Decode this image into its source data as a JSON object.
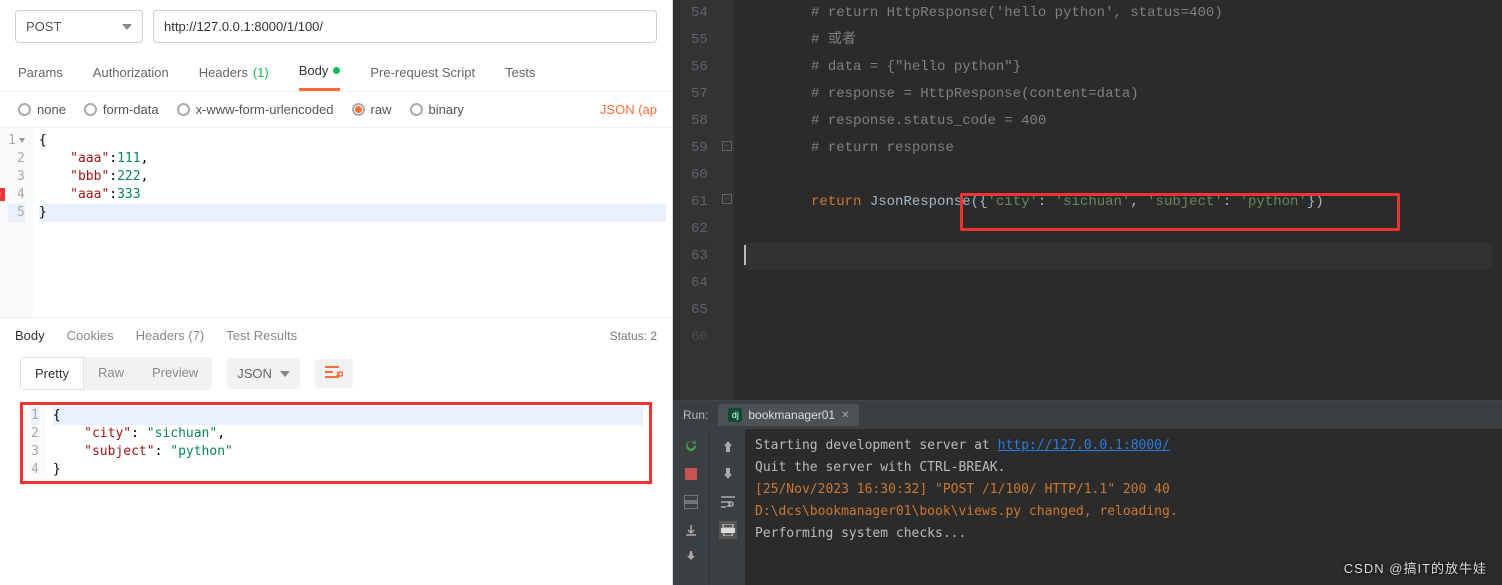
{
  "postman": {
    "method": "POST",
    "url": "http://127.0.0.1:8000/1/100/",
    "tabs": {
      "params": "Params",
      "auth": "Authorization",
      "headers": "Headers",
      "headers_count": "(1)",
      "body": "Body",
      "prerequest": "Pre-request Script",
      "tests": "Tests"
    },
    "body_types": {
      "none": "none",
      "form": "form-data",
      "urlencoded": "x-www-form-urlencoded",
      "raw": "raw",
      "binary": "binary",
      "json_label": "JSON (ap"
    },
    "request_body": {
      "lines": [
        "1",
        "2",
        "3",
        "4",
        "5"
      ],
      "l1": "{",
      "l2_k": "\"aaa\"",
      "l2_p": ":",
      "l2_v": "111",
      "l2_c": ",",
      "l3_k": "\"bbb\"",
      "l3_p": ":",
      "l3_v": "222",
      "l3_c": ",",
      "l4_k": "\"aaa\"",
      "l4_p": ":",
      "l4_v": "333",
      "l5": "}"
    },
    "response_tabs": {
      "body": "Body",
      "cookies": "Cookies",
      "headers": "Headers",
      "headers_count": "(7)",
      "tests": "Test Results",
      "status_label": "Status: 2"
    },
    "view_toolbar": {
      "pretty": "Pretty",
      "raw": "Raw",
      "preview": "Preview",
      "json": "JSON"
    },
    "response_body": {
      "lines": [
        "1",
        "2",
        "3",
        "4"
      ],
      "l1": "{",
      "l2_k": "\"city\"",
      "l2_v": "\"sichuan\"",
      "l3_k": "\"subject\"",
      "l3_v": "\"python\"",
      "l4": "}"
    }
  },
  "ide": {
    "code": {
      "lines": [
        "54",
        "55",
        "56",
        "57",
        "58",
        "59",
        "60",
        "61",
        "62",
        "63",
        "64",
        "65",
        "66"
      ],
      "c54": "# return HttpResponse('hello python', status=400)",
      "c55": "# 或者",
      "c56": "# data = {\"hello python\"}",
      "c57": "# response = HttpResponse(content=data)",
      "c58": "# response.status_code = 400",
      "c59": "# return response",
      "c61_kw": "return ",
      "c61_fn": "JsonResponse",
      "c61_rest1": "({",
      "c61_k1": "'city'",
      "c61_c1": ": ",
      "c61_v1": "'sichuan'",
      "c61_c2": ", ",
      "c61_k2": "'subject'",
      "c61_c3": ": ",
      "c61_v2": "'python'",
      "c61_rest2": "})"
    },
    "run": {
      "label": "Run:",
      "tab_name": "bookmanager01",
      "console": {
        "l1a": "Starting development server at ",
        "l1b": "http://127.0.0.1:8000/",
        "l2": "Quit the server with CTRL-BREAK.",
        "l3": "[25/Nov/2023 16:30:32] \"POST /1/100/ HTTP/1.1\" 200 40",
        "l4": "D:\\dcs\\bookmanager01\\book\\views.py changed, reloading.",
        "l5": "Performing system checks..."
      }
    }
  },
  "watermark": "CSDN @搞IT的放牛娃"
}
